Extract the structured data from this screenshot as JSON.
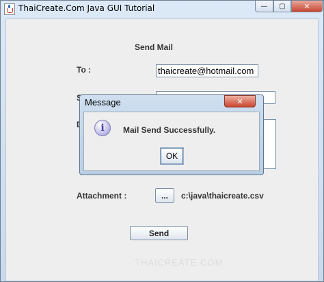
{
  "window": {
    "title": "ThaiCreate.Com Java GUI Tutorial",
    "minimize_glyph": "—",
    "maximize_glyph": "▢",
    "close_glyph": "✕"
  },
  "form": {
    "heading": "Send Mail",
    "to_label": "To :",
    "to_value": "thaicreate@hotmail.com",
    "subject_label_partial": "S",
    "body_label_partial": "D",
    "attachment_label": "Attachment :",
    "browse_button": "...",
    "attachment_path": "c:\\java\\thaicreate.csv",
    "send_button": "Send",
    "watermark": "THAICREATE.COM"
  },
  "dialog": {
    "title": "Message",
    "close_glyph": "✕",
    "icon_glyph": "i",
    "message": "Mail Send Successfully.",
    "ok_button": "OK"
  },
  "icons": {
    "app": "java-cup-icon",
    "info": "information-icon"
  }
}
